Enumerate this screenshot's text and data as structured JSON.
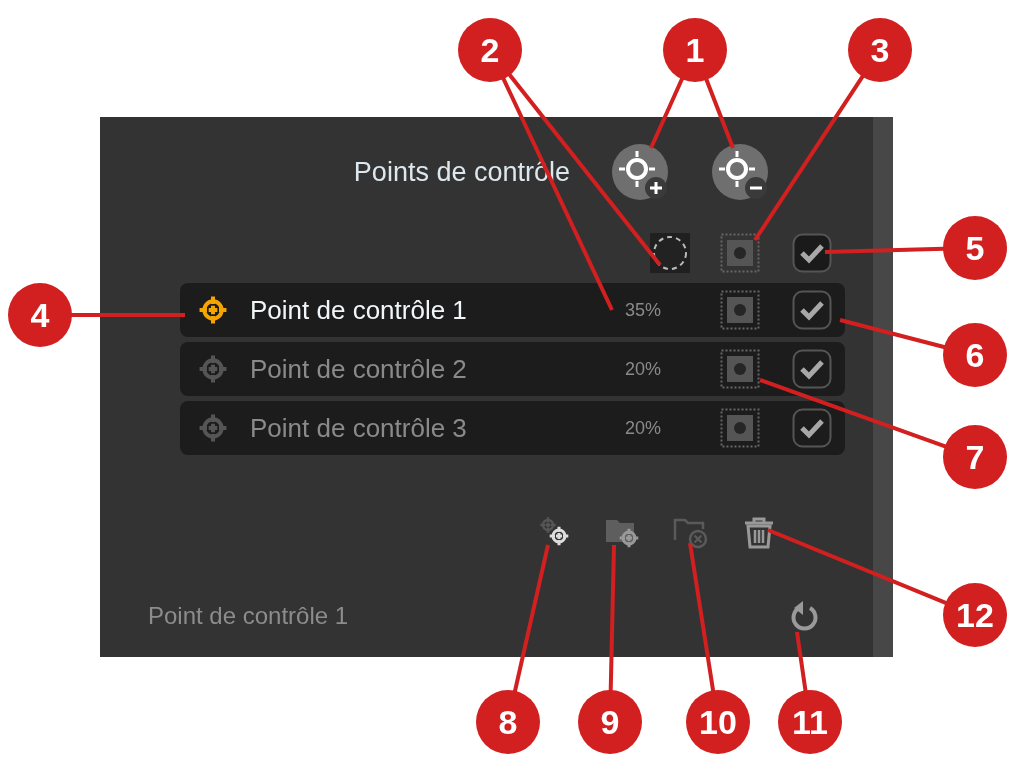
{
  "panel": {
    "title": "Points de contrôle",
    "all_visible": {
      "checked": true
    },
    "points": [
      {
        "name": "Point de contrôle 1",
        "opacity": "35%",
        "selected": true,
        "checked": true
      },
      {
        "name": "Point de contrôle 2",
        "opacity": "20%",
        "selected": false,
        "checked": true
      },
      {
        "name": "Point de contrôle 3",
        "opacity": "20%",
        "selected": false,
        "checked": true
      }
    ],
    "current_point": "Point de contrôle 1"
  },
  "callouts": [
    {
      "number": "2"
    },
    {
      "number": "1"
    },
    {
      "number": "3"
    },
    {
      "number": "5"
    },
    {
      "number": "4"
    },
    {
      "number": "6"
    },
    {
      "number": "7"
    },
    {
      "number": "12"
    },
    {
      "number": "8"
    },
    {
      "number": "9"
    },
    {
      "number": "10"
    },
    {
      "number": "11"
    }
  ]
}
